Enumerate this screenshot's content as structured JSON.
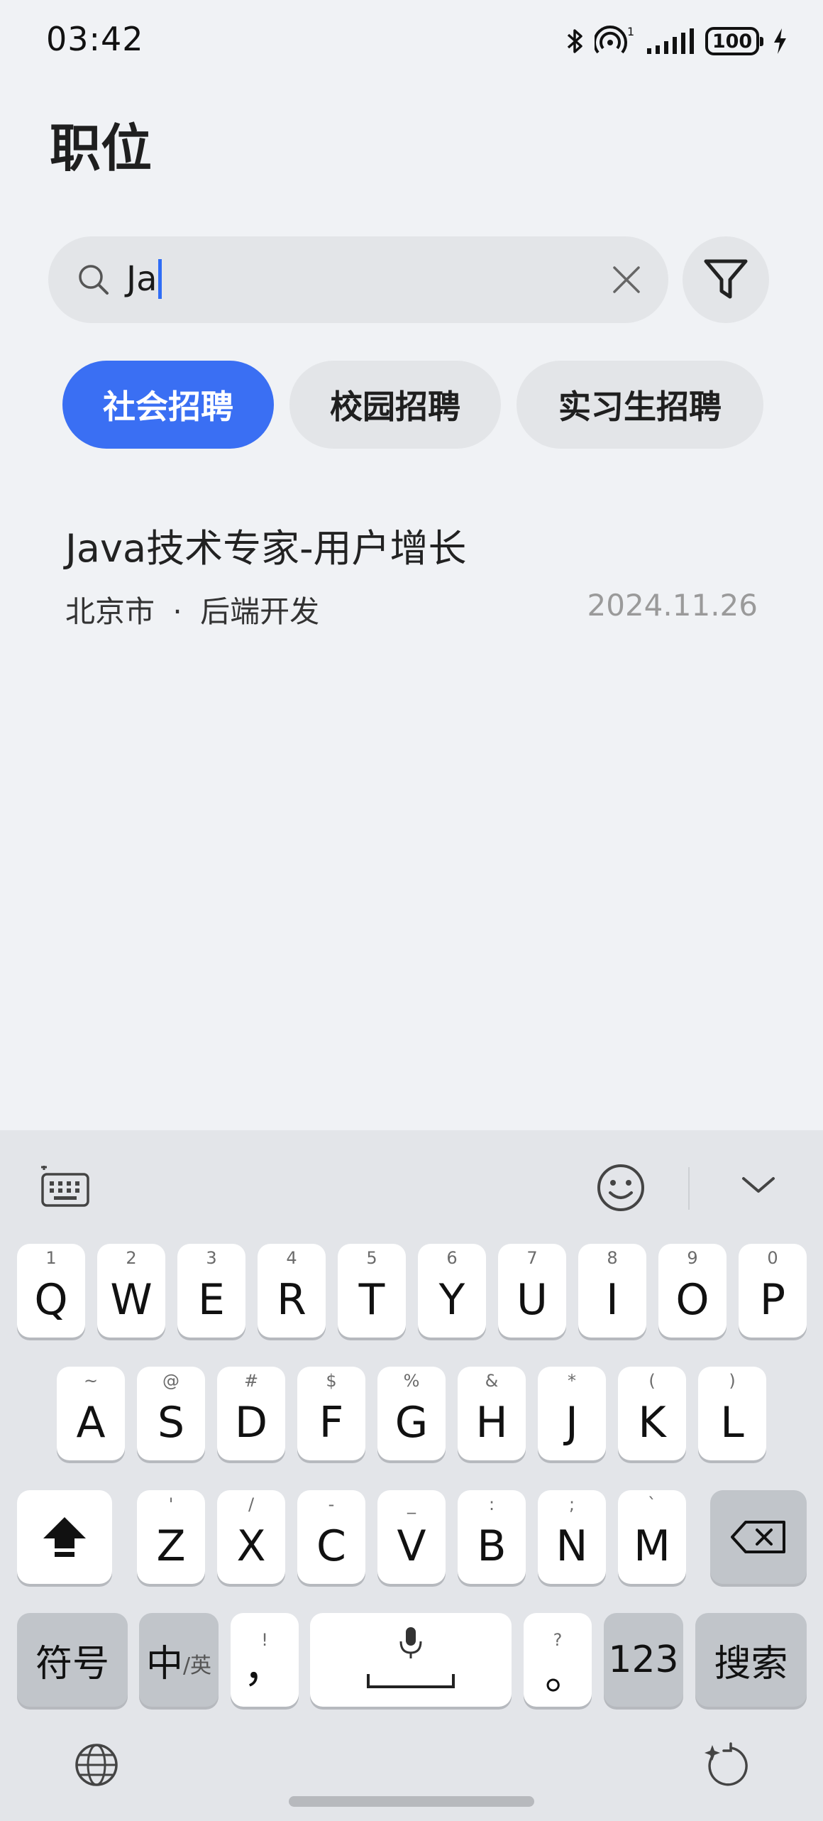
{
  "status_bar": {
    "time": "03:42",
    "battery": "100",
    "signal_label": "1",
    "icons": [
      "bluetooth-icon",
      "hotspot-icon",
      "signal-icon",
      "battery-icon",
      "charging-icon"
    ]
  },
  "page": {
    "title": "职位"
  },
  "search": {
    "value": "Ja",
    "icons": [
      "search-icon",
      "clear-icon",
      "filter-icon"
    ]
  },
  "tabs": [
    {
      "label": "社会招聘",
      "active": true
    },
    {
      "label": "校园招聘",
      "active": false
    },
    {
      "label": "实习生招聘",
      "active": false
    }
  ],
  "jobs": [
    {
      "title": "Java技术专家-用户增长",
      "location": "北京市",
      "separator": "·",
      "category": "后端开发",
      "date": "2024.11.26"
    }
  ],
  "keyboard": {
    "row1": [
      {
        "label": "Q",
        "sup": "1"
      },
      {
        "label": "W",
        "sup": "2"
      },
      {
        "label": "E",
        "sup": "3"
      },
      {
        "label": "R",
        "sup": "4"
      },
      {
        "label": "T",
        "sup": "5"
      },
      {
        "label": "Y",
        "sup": "6"
      },
      {
        "label": "U",
        "sup": "7"
      },
      {
        "label": "I",
        "sup": "8"
      },
      {
        "label": "O",
        "sup": "9"
      },
      {
        "label": "P",
        "sup": "0"
      }
    ],
    "row2": [
      {
        "label": "A",
        "sup": "~"
      },
      {
        "label": "S",
        "sup": "@"
      },
      {
        "label": "D",
        "sup": "#"
      },
      {
        "label": "F",
        "sup": "$"
      },
      {
        "label": "G",
        "sup": "%"
      },
      {
        "label": "H",
        "sup": "&"
      },
      {
        "label": "J",
        "sup": "*"
      },
      {
        "label": "K",
        "sup": "("
      },
      {
        "label": "L",
        "sup": ")"
      }
    ],
    "row3": [
      {
        "label": "Z",
        "sup": "'"
      },
      {
        "label": "X",
        "sup": "/"
      },
      {
        "label": "C",
        "sup": "-"
      },
      {
        "label": "V",
        "sup": "_"
      },
      {
        "label": "B",
        "sup": ":"
      },
      {
        "label": "N",
        "sup": ";"
      },
      {
        "label": "M",
        "sup": "`"
      }
    ],
    "symbols_label": "符号",
    "lang_main": "中",
    "lang_alt": "/英",
    "comma": "，",
    "comma_sup": "!",
    "period": "。",
    "period_sup": "?",
    "numbers_label": "123",
    "search_label": "搜索"
  },
  "colors": {
    "accent": "#3a6ff3",
    "background": "#f0f2f5",
    "keyboard_bg": "#e3e5e9"
  }
}
